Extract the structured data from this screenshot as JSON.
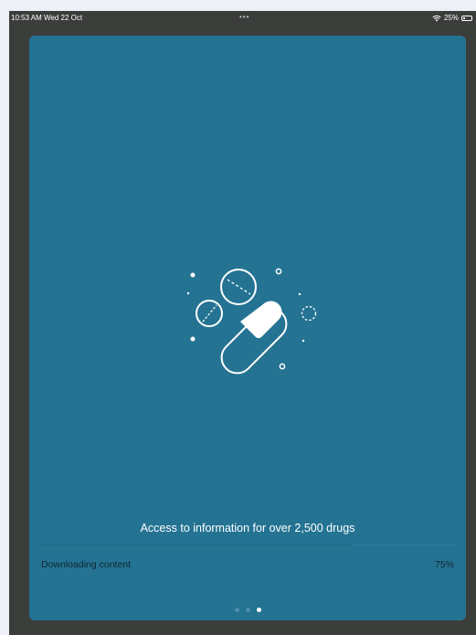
{
  "status_bar": {
    "time_date": "10:53 AM  Wed 22 Oct",
    "more": "•••",
    "wifi_icon": "wifi-icon",
    "battery_percent": "25%",
    "battery_level": 0.25
  },
  "onboarding": {
    "illustration_icon": "pills-icon",
    "tagline": "Access to information for over 2,500 drugs",
    "download": {
      "label": "Downloading content",
      "percent_text": "75%",
      "progress": 0.75
    },
    "pager": {
      "count": 3,
      "active_index": 2
    }
  },
  "colors": {
    "card_background": "#247393",
    "frame_background": "#3b3d3b",
    "page_background": "#eef0f7",
    "text_light": "#ffffff",
    "text_dark": "#0f2530"
  }
}
